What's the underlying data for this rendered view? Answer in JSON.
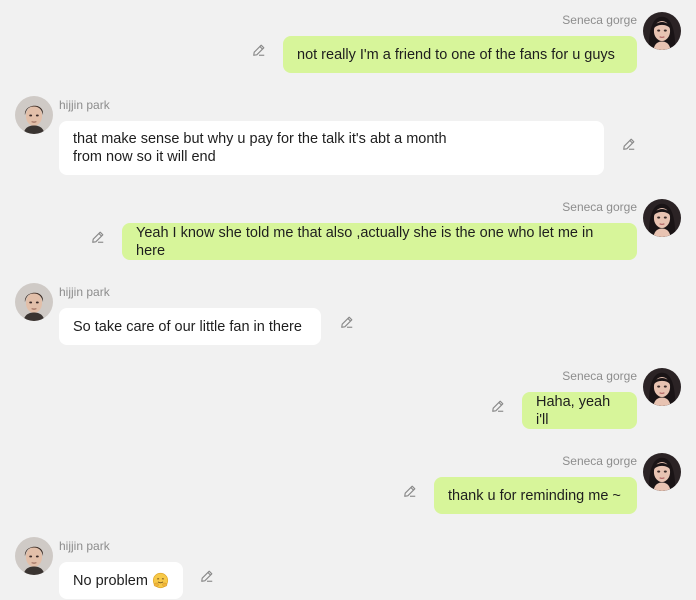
{
  "participants": {
    "self_name": "Seneca gorge",
    "other_name": "hijjin park"
  },
  "messages": [
    {
      "sender": "Seneca gorge",
      "text": "not  really I'm a friend to  one of the fans for u guys"
    },
    {
      "sender": "hijjin park",
      "text": "that make sense but why u pay for the talk it's abt a month\nfrom now so it will end"
    },
    {
      "sender": "Seneca gorge",
      "text": "Yeah I know she told me that also ,actually she is the one who let me in here"
    },
    {
      "sender": "hijjin park",
      "text": "So take care of our  little fan in there"
    },
    {
      "sender": "Seneca gorge",
      "text": "Haha, yeah i'll"
    },
    {
      "sender": "Seneca gorge",
      "text": "thank u for reminding me ~"
    },
    {
      "sender": "hijjin park",
      "text": "No problem",
      "emoji": "hugging-face-emoji"
    }
  ],
  "colors": {
    "background": "#f1f1f1",
    "self_bubble": "#d7f59a",
    "other_bubble": "#ffffff",
    "name_text": "#8d8d8d",
    "icon": "#8a8a8a"
  },
  "icons": {
    "edit": "pencil-icon",
    "self_avatar": "avatar-seneca-gorge",
    "other_avatar": "avatar-hijjin-park"
  }
}
